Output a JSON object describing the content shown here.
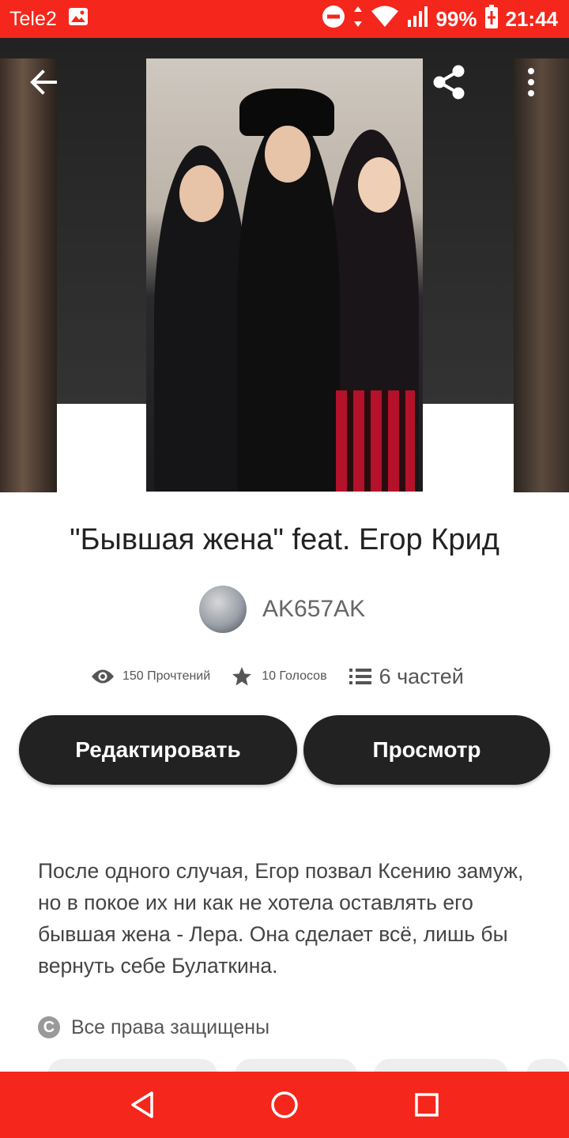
{
  "status_bar": {
    "carrier": "Tele2",
    "battery": "99%",
    "time": "21:44",
    "color": "#f5261b"
  },
  "story": {
    "title": "\"Бывшая жена\" feat. Егор Крид",
    "author": "AK657AK",
    "stats": {
      "reads": "150 Прочтений",
      "votes": "10 Голосов",
      "parts": "6 частей"
    },
    "description": "После одного случая, Егор позвал Ксению замуж, но в покое их ни как не хотела оставлять его бывшая жена - Лера. Она сделает всё, лишь бы вернуть себе Булаткина.",
    "copyright": "Все права защищены"
  },
  "actions": {
    "edit_label": "Редактировать",
    "view_label": "Просмотр"
  },
  "icons": {
    "back": "arrow-left-icon",
    "share": "share-icon",
    "more": "more-vertical-icon",
    "reads": "eye-icon",
    "votes": "star-icon",
    "parts": "list-icon",
    "copyright": "copyright-icon"
  },
  "colors": {
    "accent": "#f5261b",
    "button": "#222222"
  }
}
